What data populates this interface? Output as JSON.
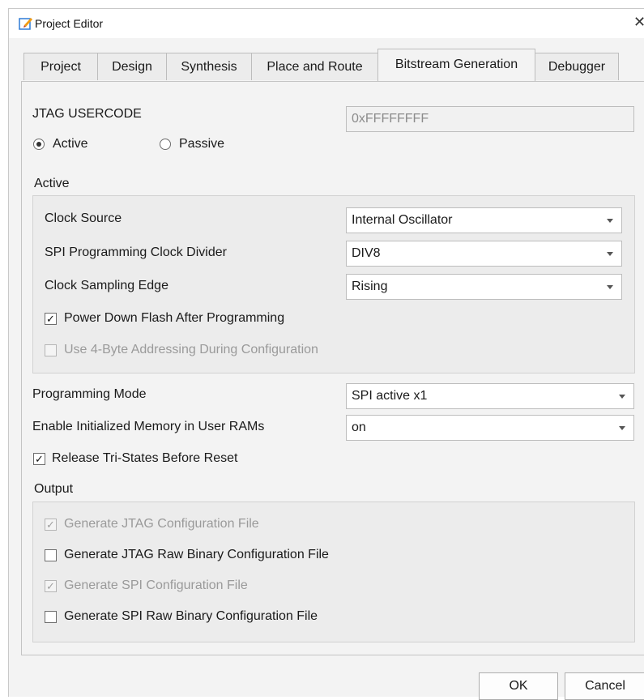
{
  "window": {
    "title": "Project Editor",
    "close_glyph": "✕"
  },
  "tabs": [
    "Project",
    "Design",
    "Synthesis",
    "Place and Route",
    "Bitstream Generation",
    "Debugger"
  ],
  "active_tab": "Bitstream Generation",
  "jtag": {
    "label": "JTAG USERCODE",
    "value": "0xFFFFFFFF"
  },
  "mode_radio": {
    "active_label": "Active",
    "passive_label": "Passive",
    "selected": "Active"
  },
  "active_group": {
    "title": "Active",
    "clock_source": {
      "label": "Clock Source",
      "value": "Internal Oscillator"
    },
    "spi_divider": {
      "label": "SPI Programming Clock Divider",
      "value": "DIV8"
    },
    "sampling_edge": {
      "label": "Clock Sampling Edge",
      "value": "Rising"
    },
    "power_down": {
      "label": "Power Down Flash After Programming",
      "checked": true
    },
    "four_byte": {
      "label": "Use 4-Byte Addressing During Configuration",
      "checked": false,
      "enabled": false
    }
  },
  "programming_mode": {
    "label": "Programming Mode",
    "value": "SPI active x1"
  },
  "init_memory": {
    "label": "Enable Initialized Memory in User RAMs",
    "value": "on"
  },
  "release_tristates": {
    "label": "Release Tri-States Before Reset",
    "checked": true
  },
  "output": {
    "title": "Output",
    "jtag_config": {
      "label": "Generate JTAG Configuration File",
      "checked": true,
      "enabled": false
    },
    "jtag_raw": {
      "label": "Generate JTAG Raw Binary Configuration File",
      "checked": false
    },
    "spi_config": {
      "label": "Generate SPI Configuration File",
      "checked": true,
      "enabled": false
    },
    "spi_raw": {
      "label": "Generate SPI Raw Binary Configuration File",
      "checked": false
    }
  },
  "buttons": {
    "ok": "OK",
    "cancel": "Cancel"
  },
  "check_glyph": "✓",
  "colors": {
    "icon_orange": "#f39c12",
    "icon_blue": "#2e7bd6"
  }
}
